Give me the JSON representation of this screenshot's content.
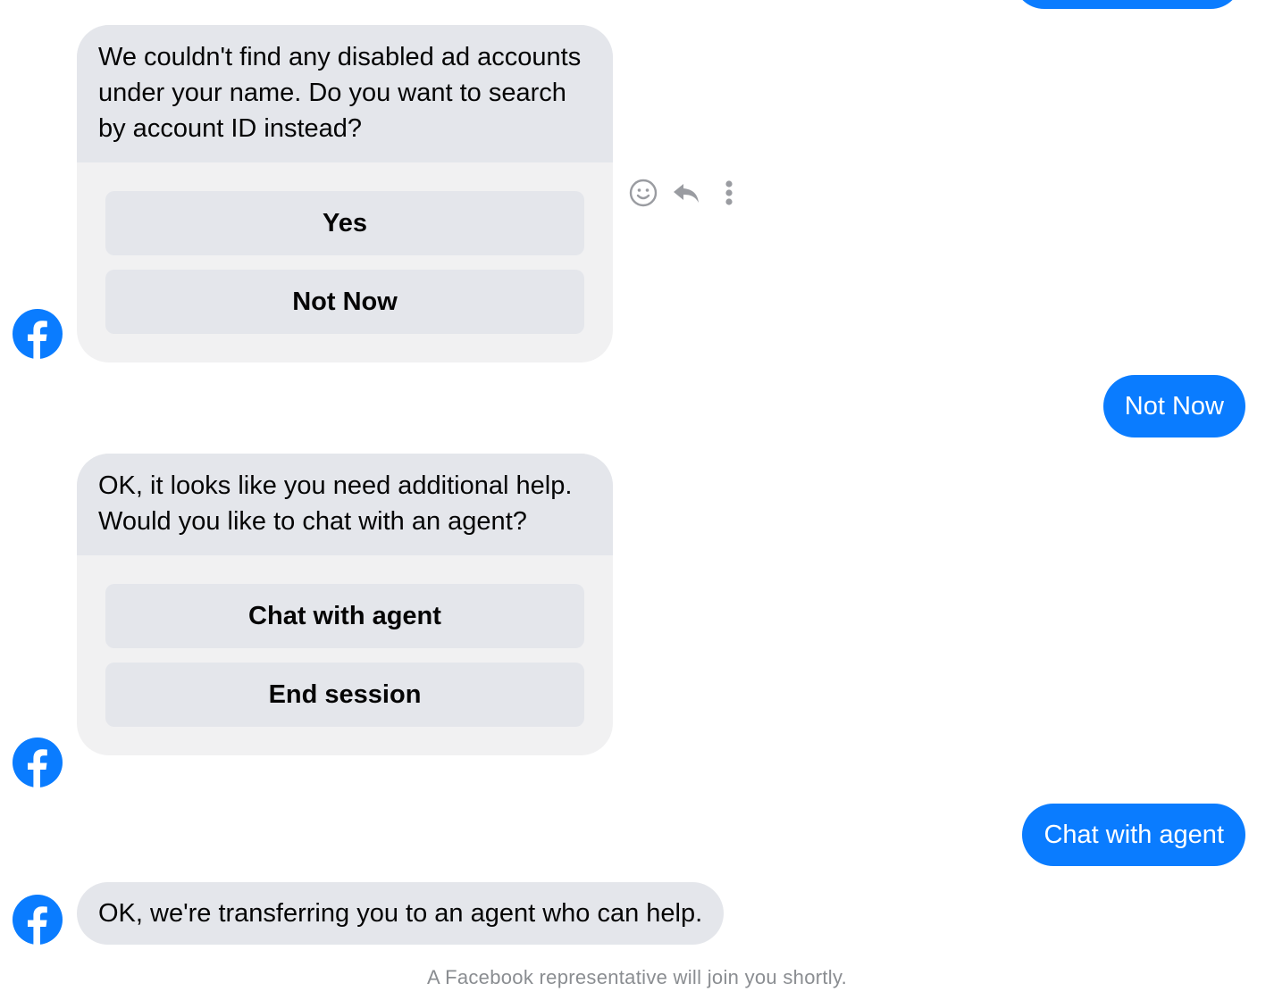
{
  "messages": {
    "msg1": {
      "text": "We couldn't find any disabled ad accounts under your name. Do you want to search by account ID instead?",
      "buttons": [
        "Yes",
        "Not Now"
      ]
    },
    "reply1": "Not Now",
    "msg2": {
      "text": "OK, it looks like you need additional help. Would you like to chat with an agent?",
      "buttons": [
        "Chat with agent",
        "End session"
      ]
    },
    "reply2": "Chat with agent",
    "msg3": "OK, we're transferring you to an agent who can help."
  },
  "footer": "A Facebook representative will join you shortly.",
  "icons": {
    "avatar": "facebook-logo-icon",
    "react": "smiley-icon",
    "reply": "reply-arrow-icon",
    "more": "more-vertical-icon"
  },
  "colors": {
    "brand": "#0a7cff",
    "incoming_bubble": "#e4e6eb",
    "card_background": "#f1f1f2",
    "footer_text": "#8a8d91"
  }
}
